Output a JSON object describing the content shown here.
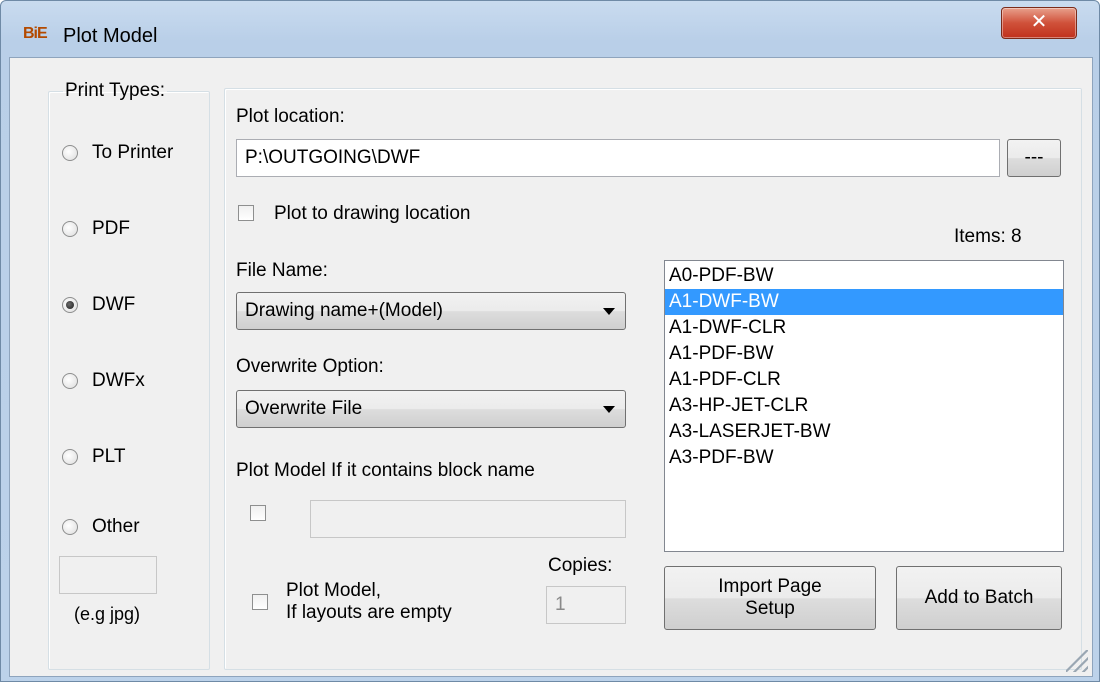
{
  "window": {
    "icon_text": "BiE",
    "title": "Plot Model",
    "close_glyph": "✕"
  },
  "print_types": {
    "legend": "Print Types:",
    "options": [
      {
        "label": "To Printer",
        "checked": false
      },
      {
        "label": "PDF",
        "checked": false
      },
      {
        "label": "DWF",
        "checked": true
      },
      {
        "label": "DWFx",
        "checked": false
      },
      {
        "label": "PLT",
        "checked": false
      },
      {
        "label": "Other",
        "checked": false
      }
    ],
    "other_ext_value": "",
    "other_hint": "(e.g jpg)"
  },
  "plot_location": {
    "label": "Plot location:",
    "value": "P:\\OUTGOING\\DWF",
    "browse_label": "---",
    "to_drawing_location_label": "Plot to drawing location",
    "to_drawing_location_checked": false
  },
  "file_name": {
    "label": "File Name:",
    "selected": "Drawing name+(Model)"
  },
  "overwrite": {
    "label": "Overwrite Option:",
    "selected": "Overwrite File"
  },
  "block_filter": {
    "label": "Plot Model If it contains block name",
    "checked": false,
    "value": ""
  },
  "empty_layouts": {
    "label_line1": "Plot  Model,",
    "label_line2": "If layouts are empty",
    "checked": false
  },
  "copies": {
    "label": "Copies:",
    "value": "1"
  },
  "page_setups": {
    "count_label": "Items: 8",
    "items": [
      "A0-PDF-BW",
      "A1-DWF-BW",
      "A1-DWF-CLR",
      "A1-PDF-BW",
      "A1-PDF-CLR",
      "A3-HP-JET-CLR",
      "A3-LASERJET-BW",
      "A3-PDF-BW"
    ],
    "selected_index": 1
  },
  "buttons": {
    "import_line1": "Import Page",
    "import_line2": "Setup",
    "add_to_batch": "Add to Batch"
  },
  "colors": {
    "selection": "#3399ff",
    "close_button": "#c9402a"
  }
}
